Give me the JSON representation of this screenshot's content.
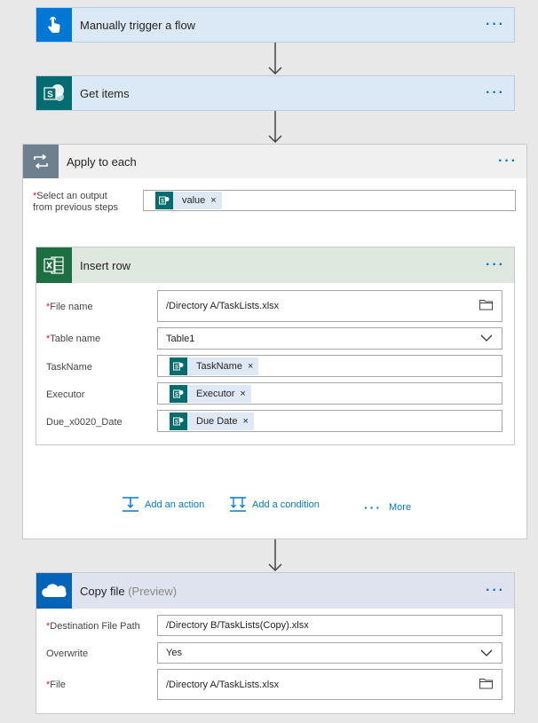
{
  "steps": {
    "trigger": {
      "title": "Manually trigger a flow",
      "more": "···"
    },
    "get_items": {
      "title": "Get items",
      "more": "···"
    },
    "apply_each": {
      "title": "Apply to each",
      "more": "···",
      "select_output_label_1": "Select an output",
      "select_output_label_2": "from previous steps",
      "required_mark": "*",
      "select_output_token": "value",
      "insert_row": {
        "title": "Insert row",
        "more": "···",
        "file_name_label": "File name",
        "file_name_value": "/Directory A/TaskLists.xlsx",
        "table_name_label": "Table name",
        "table_name_value": "Table1",
        "taskname_label": "TaskName",
        "taskname_token": "TaskName",
        "executor_label": "Executor",
        "executor_token": "Executor",
        "due_label": "Due_x0020_Date",
        "due_token": "Due Date"
      },
      "add_action": "Add an action",
      "add_condition": "Add a condition",
      "more_label": "More"
    },
    "copy_file": {
      "title": "Copy file",
      "preview": "(Preview)",
      "more": "···",
      "dest_label": "Destination File Path",
      "dest_value": "/Directory B/TaskLists(Copy).xlsx",
      "overwrite_label": "Overwrite",
      "overwrite_value": "Yes",
      "file_label": "File",
      "file_value": "/Directory A/TaskLists.xlsx"
    }
  },
  "token_close": "×",
  "colors": {
    "trigger_icon_bg": "#0078d4",
    "trigger_header_bg": "#dbe8f5",
    "sharepoint_icon_bg": "#036c70",
    "apply_icon_bg": "#6e7f8d",
    "apply_header_bg": "#f0f0f0",
    "excel_icon_bg": "#1d6f42",
    "excel_header_bg": "#dfe8df",
    "onedrive_icon_bg": "#0364b8",
    "copy_header_bg": "#dfe3ef",
    "link": "#0078d4"
  },
  "icons": {
    "trigger": "hand-pointer-icon",
    "sharepoint": "sharepoint-icon",
    "loop": "loop-icon",
    "excel": "excel-icon",
    "onedrive": "onedrive-icon",
    "folder": "folder-icon",
    "chevron": "chevron-down-icon"
  }
}
